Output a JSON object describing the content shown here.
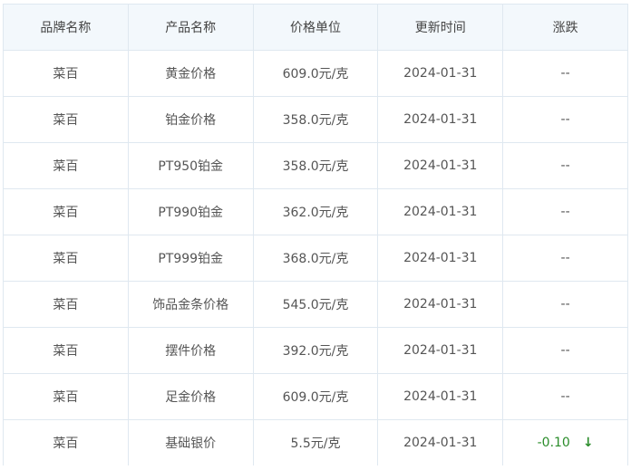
{
  "table": {
    "headers": [
      "品牌名称",
      "产品名称",
      "价格单位",
      "更新时间",
      "涨跌"
    ],
    "rows": [
      {
        "brand": "菜百",
        "product": "黄金价格",
        "price": "609.0元/克",
        "date": "2024-01-31",
        "change": "--"
      },
      {
        "brand": "菜百",
        "product": "铂金价格",
        "price": "358.0元/克",
        "date": "2024-01-31",
        "change": "--"
      },
      {
        "brand": "菜百",
        "product": "PT950铂金",
        "price": "358.0元/克",
        "date": "2024-01-31",
        "change": "--"
      },
      {
        "brand": "菜百",
        "product": "PT990铂金",
        "price": "362.0元/克",
        "date": "2024-01-31",
        "change": "--"
      },
      {
        "brand": "菜百",
        "product": "PT999铂金",
        "price": "368.0元/克",
        "date": "2024-01-31",
        "change": "--"
      },
      {
        "brand": "菜百",
        "product": "饰品金条价格",
        "price": "545.0元/克",
        "date": "2024-01-31",
        "change": "--"
      },
      {
        "brand": "菜百",
        "product": "摆件价格",
        "price": "392.0元/克",
        "date": "2024-01-31",
        "change": "--"
      },
      {
        "brand": "菜百",
        "product": "足金价格",
        "price": "609.0元/克",
        "date": "2024-01-31",
        "change": "--"
      },
      {
        "brand": "菜百",
        "product": "基础银价",
        "price": "5.5元/克",
        "date": "2024-01-31",
        "change": "-0.10",
        "arrow": "↓"
      }
    ]
  },
  "colors": {
    "header_bg": "#f3f8fc",
    "border": "#dfe8f0",
    "change_down": "#2a8c2a"
  }
}
